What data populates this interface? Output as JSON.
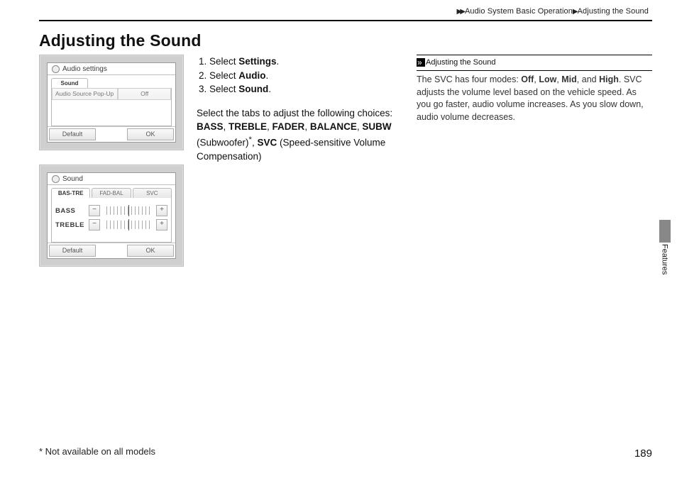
{
  "running_head": {
    "path1": "Audio System Basic Operation",
    "path2": "Adjusting the Sound"
  },
  "heading": "Adjusting the Sound",
  "steps": {
    "s1_prefix": "Select ",
    "s1_bold": "Settings",
    "s1_suffix": ".",
    "s2_prefix": "Select ",
    "s2_bold": "Audio",
    "s2_suffix": ".",
    "s3_prefix": "Select ",
    "s3_bold": "Sound",
    "s3_suffix": "."
  },
  "body": {
    "lead": "Select the tabs to adjust the following choices:",
    "b1": "BASS",
    "sep": ", ",
    "b2": "TREBLE",
    "b3": "FADER",
    "b4": "BALANCE",
    "b5": "SUBW",
    "paren1_a": " (Subwoofer)",
    "asterisk": "*",
    "sep2": ", ",
    "b6": "SVC",
    "paren2": " (Speed-sensitive Volume Compensation)"
  },
  "callout": {
    "title": "Adjusting the Sound",
    "t1": "The SVC has four modes: ",
    "m1": "Off",
    "c": ", ",
    "m2": "Low",
    "m3": "Mid",
    "and": ", and ",
    "m4": "High",
    "dot": ". ",
    "t2": "SVC adjusts the volume level based on the vehicle speed. As you go faster, audio volume increases. As you slow down, audio volume decreases."
  },
  "shot1": {
    "title": "Audio settings",
    "tab": "Sound",
    "row_label": "Audio Source Pop-Up",
    "row_value": "Off",
    "btn_default": "Default",
    "btn_ok": "OK"
  },
  "shot2": {
    "title": "Sound",
    "tab1": "BAS-TRE",
    "tab2": "FAD-BAL",
    "tab3": "SVC",
    "row1": "BASS",
    "row2": "TREBLE",
    "minus": "−",
    "plus": "+",
    "btn_default": "Default",
    "btn_ok": "OK"
  },
  "side_tab": "Features",
  "footnote": "* Not available on all models",
  "page_number": "189"
}
